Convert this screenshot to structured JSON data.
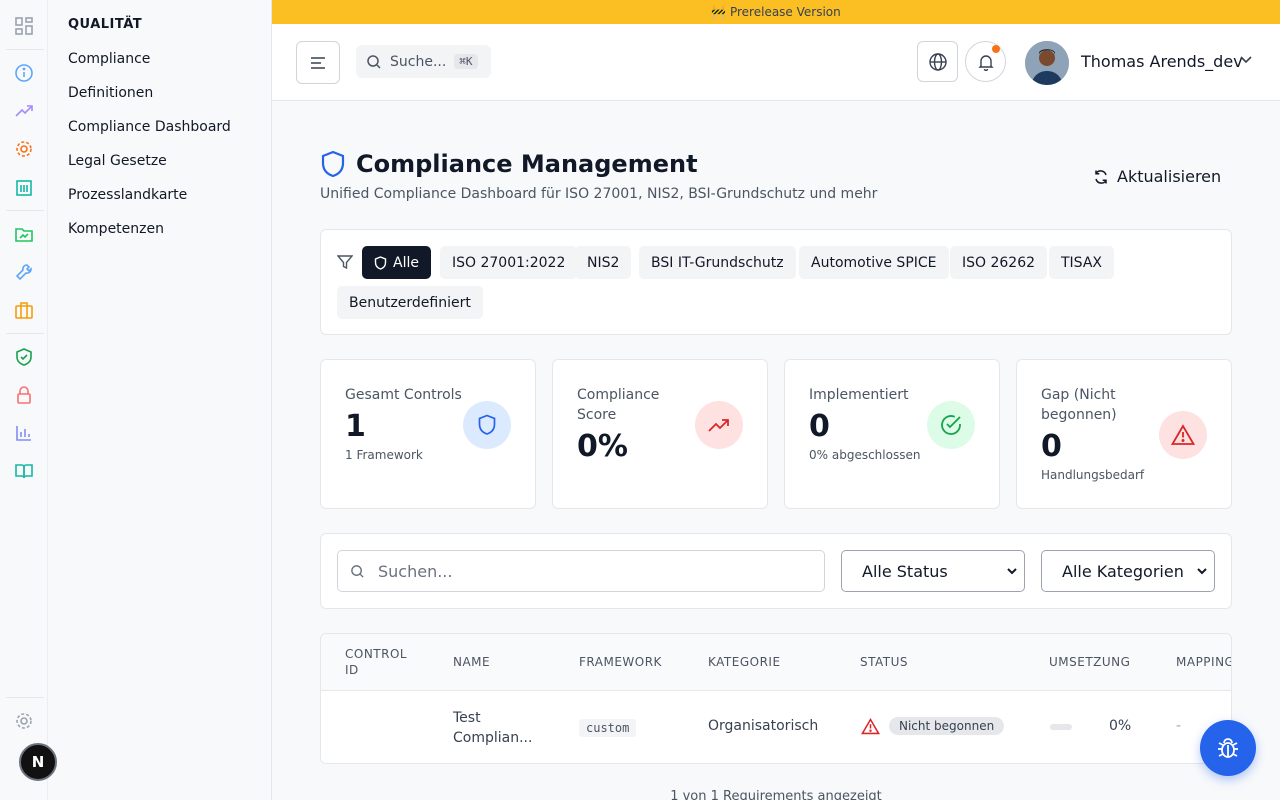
{
  "rail": {
    "icons": [
      "grid-icon",
      "info-icon",
      "trend-icon",
      "gear-orange-icon",
      "building-icon",
      "folder-chart-icon",
      "wrench-icon",
      "briefcase-icon",
      "shield-check-icon",
      "lock-icon",
      "bar-chart-icon",
      "book-icon",
      "settings-icon"
    ],
    "avatar_letter": "N"
  },
  "subnav": {
    "title": "QUALITÄT",
    "items": [
      "Compliance",
      "Definitionen",
      "Compliance Dashboard",
      "Legal Gesetze",
      "Prozesslandkarte",
      "Kompetenzen"
    ]
  },
  "banner": {
    "text": "🚧 Prerelease Version",
    "color": "#fbbf24"
  },
  "header": {
    "search_label": "Suche...",
    "search_shortcut": "⌘K",
    "user_name": "Thomas Arends_dev"
  },
  "page": {
    "title": "Compliance Management",
    "subtitle": "Unified Compliance Dashboard für ISO 27001, NIS2, BSI-Grundschutz und mehr",
    "refresh_label": "Aktualisieren"
  },
  "filters": {
    "chips": [
      "Alle",
      "ISO 27001:2022",
      "NIS2",
      "BSI IT-Grundschutz",
      "Automotive SPICE",
      "ISO 26262",
      "TISAX",
      "Benutzerdefiniert"
    ],
    "active": "Alle"
  },
  "stats": [
    {
      "label": "Gesamt Controls",
      "value": "1",
      "sub": "1 Framework",
      "icon": "shield-icon",
      "color": "#dbeafe"
    },
    {
      "label": "Compliance Score",
      "value": "0%",
      "sub": "",
      "icon": "trend-up-icon",
      "color": "#fee2e2"
    },
    {
      "label": "Implementiert",
      "value": "0",
      "sub": "0% abgeschlossen",
      "icon": "check-circle-icon",
      "color": "#dcfce7"
    },
    {
      "label": "Gap (Nicht begonnen)",
      "value": "0",
      "sub": "Handlungsbedarf",
      "icon": "warning-icon",
      "color": "#fee2e2"
    }
  ],
  "table_tools": {
    "search_placeholder": "Suchen...",
    "status_select": "Alle Status",
    "category_select": "Alle Kategorien"
  },
  "table": {
    "headers": [
      "CONTROL ID",
      "NAME",
      "FRAMEWORK",
      "KATEGORIE",
      "STATUS",
      "UMSETZUNG",
      "MAPPINGS"
    ],
    "rows": [
      {
        "control_id": "",
        "name_line1": "Test",
        "name_line2": "Complian...",
        "framework": "custom",
        "category": "Organisatorisch",
        "status": "Nicht begonnen",
        "progress_label": "0%",
        "progress": 0,
        "mappings": "-"
      }
    ]
  },
  "footer": "1 von 1 Requirements angezeigt"
}
